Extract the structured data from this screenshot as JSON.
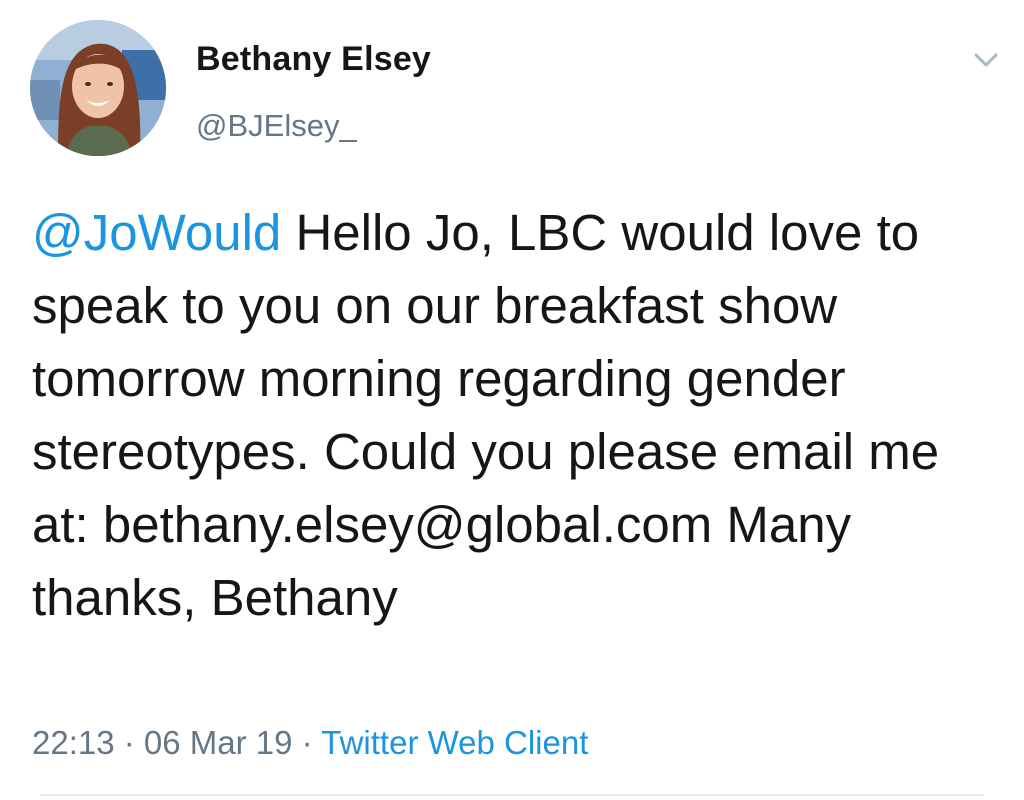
{
  "author": {
    "display_name": "Bethany Elsey",
    "handle": "@BJElsey_"
  },
  "tweet": {
    "mention": "@JoWould",
    "text": " Hello Jo, LBC would love to speak to you on our breakfast show tomorrow morning regarding gender stereotypes. Could you please email me at: bethany.elsey@global.com Many thanks, Bethany"
  },
  "meta": {
    "time": "22:13",
    "separator": " · ",
    "date": "06 Mar 19",
    "source": "Twitter Web Client"
  },
  "icons": {
    "menu": "chevron-down-icon"
  },
  "colors": {
    "link": "#1b95e0",
    "text": "#14171a",
    "muted": "#657786"
  }
}
